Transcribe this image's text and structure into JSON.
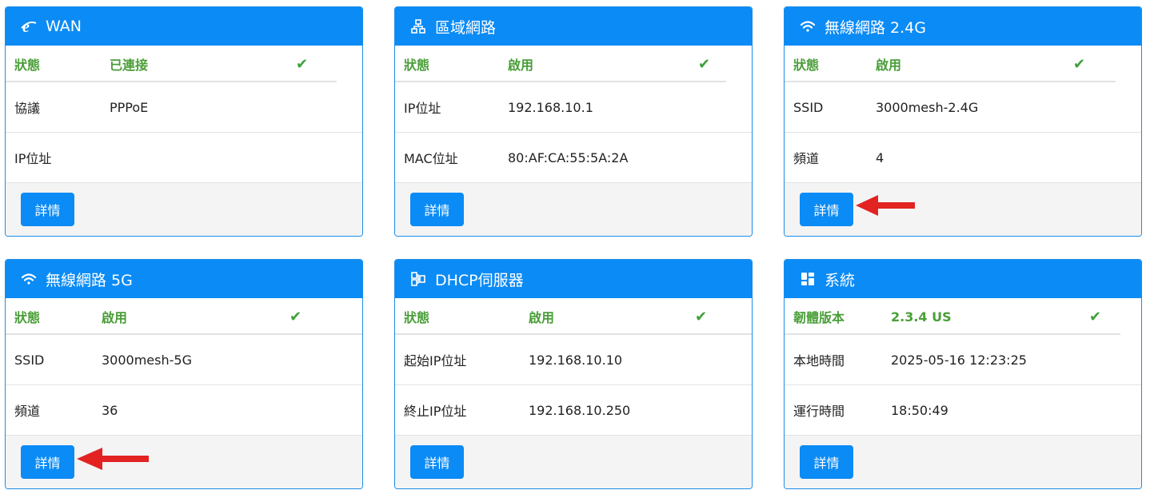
{
  "colors": {
    "header": "#0b8bf5",
    "status_green": "#4a9e38",
    "button": "#0b8bf5",
    "arrow": "#e32222"
  },
  "cards": [
    {
      "title": "WAN",
      "icon": "ie-icon",
      "status_label": "狀態",
      "status_value": "已連接",
      "rows": [
        {
          "label": "協議",
          "value": "PPPoE"
        },
        {
          "label": "IP位址",
          "value": ""
        }
      ],
      "button": "詳情"
    },
    {
      "title": "區域網路",
      "icon": "network-icon",
      "status_label": "狀態",
      "status_value": "啟用",
      "rows": [
        {
          "label": "IP位址",
          "value": "192.168.10.1"
        },
        {
          "label": "MAC位址",
          "value": "80:AF:CA:55:5A:2A"
        }
      ],
      "button": "詳情"
    },
    {
      "title": "無線網路 2.4G",
      "icon": "wifi-icon",
      "status_label": "狀態",
      "status_value": "啟用",
      "rows": [
        {
          "label": "SSID",
          "value": "3000mesh-2.4G"
        },
        {
          "label": "頻道",
          "value": "4"
        }
      ],
      "button": "詳情"
    },
    {
      "title": "無線網路 5G",
      "icon": "wifi-icon",
      "status_label": "狀態",
      "status_value": "啟用",
      "rows": [
        {
          "label": "SSID",
          "value": "3000mesh-5G"
        },
        {
          "label": "頻道",
          "value": "36"
        }
      ],
      "button": "詳情"
    },
    {
      "title": "DHCP伺服器",
      "icon": "dhcp-icon",
      "status_label": "狀態",
      "status_value": "啟用",
      "rows": [
        {
          "label": "起始IP位址",
          "value": "192.168.10.10"
        },
        {
          "label": "終止IP位址",
          "value": "192.168.10.250"
        }
      ],
      "button": "詳情"
    },
    {
      "title": "系統",
      "icon": "dashboard-icon",
      "status_label": "韌體版本",
      "status_value": "2.3.4 US",
      "rows": [
        {
          "label": "本地時間",
          "value": "2025-05-16 12:23:25"
        },
        {
          "label": "運行時間",
          "value": "18:50:49"
        }
      ],
      "button": "詳情"
    }
  ]
}
